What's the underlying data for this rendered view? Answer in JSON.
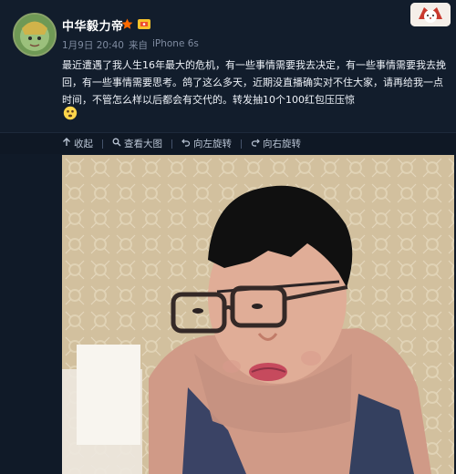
{
  "post": {
    "username": "中华毅力帝",
    "time": "1月9日 20:40",
    "source_prefix": "来自",
    "source": "iPhone 6s",
    "text": "最近遭遇了我人生16年最大的危机，有一些事情需要我去决定，有一些事情需要我去挽回，有一些事情需要思考。鸽了这么多天，近期没直播确实对不住大家，请再给我一点时间，不管怎么样以后都会有交代的。转发抽10个100红包压压惊"
  },
  "toolbar": {
    "collect_label": "收起",
    "view_label": "查看大图",
    "rotate_left_label": "向左旋转",
    "rotate_right_label": "向右旋转"
  },
  "colors": {
    "background": "#101a28",
    "header_background": "#121d2c",
    "text": "#eef2f8",
    "meta": "#7f8ba0",
    "toolbar_text": "#b8c3d3",
    "vip_orange": "#ff7a00"
  },
  "icons": {
    "up_arrow": "up-arrow-icon",
    "search": "search-icon",
    "rotate_left": "rotate-left-icon",
    "rotate_right": "rotate-right-icon",
    "star_badge": "star-badge-icon",
    "vip_badge": "vip-badge-icon",
    "emoji": "shocked-face-icon"
  }
}
